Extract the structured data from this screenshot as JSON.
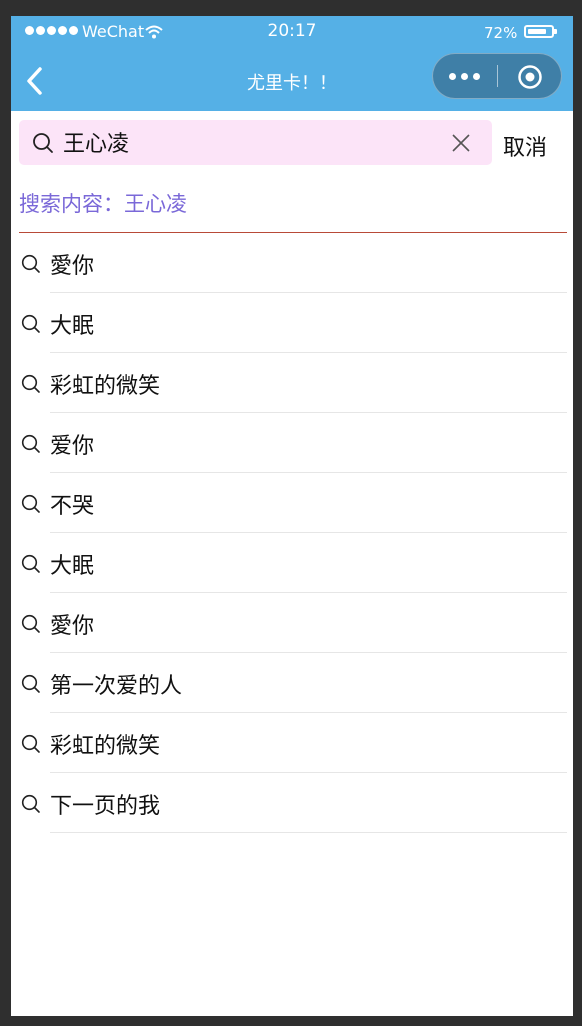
{
  "status_bar": {
    "carrier": "WeChat",
    "time": "20:17",
    "battery": "72%",
    "battery_level": 0.72
  },
  "nav": {
    "title": "尤里卡！！",
    "back_icon": "chevron-left-icon",
    "more_icon": "more-dots-icon",
    "close_icon": "target-circle-icon"
  },
  "search": {
    "value": "王心凌",
    "placeholder": "",
    "search_icon": "search-icon",
    "clear_icon": "close-icon",
    "cancel_label": "取消"
  },
  "query_label": "搜索内容：王心凌",
  "results": [
    {
      "text": "愛你"
    },
    {
      "text": "大眠"
    },
    {
      "text": "彩虹的微笑"
    },
    {
      "text": "爱你"
    },
    {
      "text": "不哭"
    },
    {
      "text": "大眠"
    },
    {
      "text": "愛你"
    },
    {
      "text": "第一次爱的人"
    },
    {
      "text": "彩虹的微笑"
    },
    {
      "text": "下一页的我"
    }
  ],
  "colors": {
    "header_bg": "#55b0e6",
    "search_bg": "#fce4f8",
    "query_text": "#7a68d8",
    "divider": "#b84a38"
  }
}
